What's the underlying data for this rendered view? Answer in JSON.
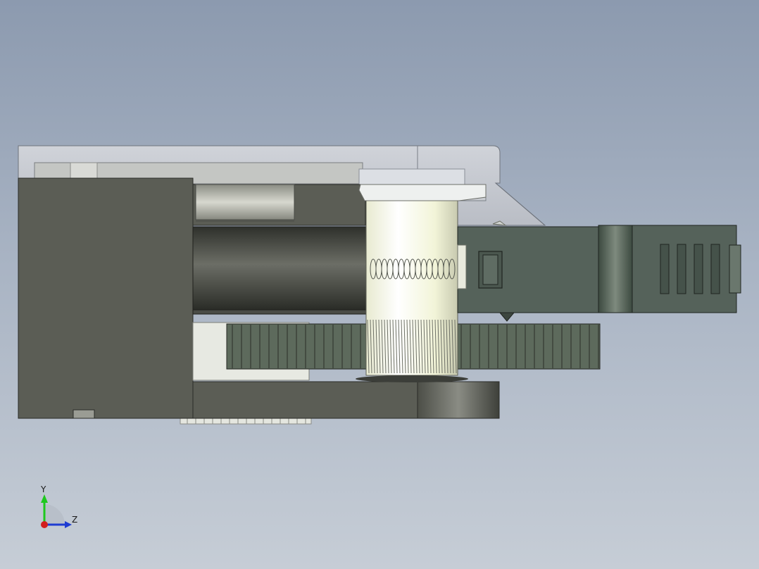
{
  "viewport": {
    "background_top": "#8c9aaf",
    "background_bottom": "#c6cdd6"
  },
  "model": {
    "body_color": "#5b5d55",
    "gear_color": "#5d6a5c",
    "shaft_color": "#f7f8e8",
    "transparent_cover_color": "#d8dbe0"
  },
  "triad": {
    "y_label": "Y",
    "z_label": "Z",
    "y_color": "#1ec81e",
    "z_color": "#1e3cd2",
    "x_color": "#d21e1e"
  }
}
